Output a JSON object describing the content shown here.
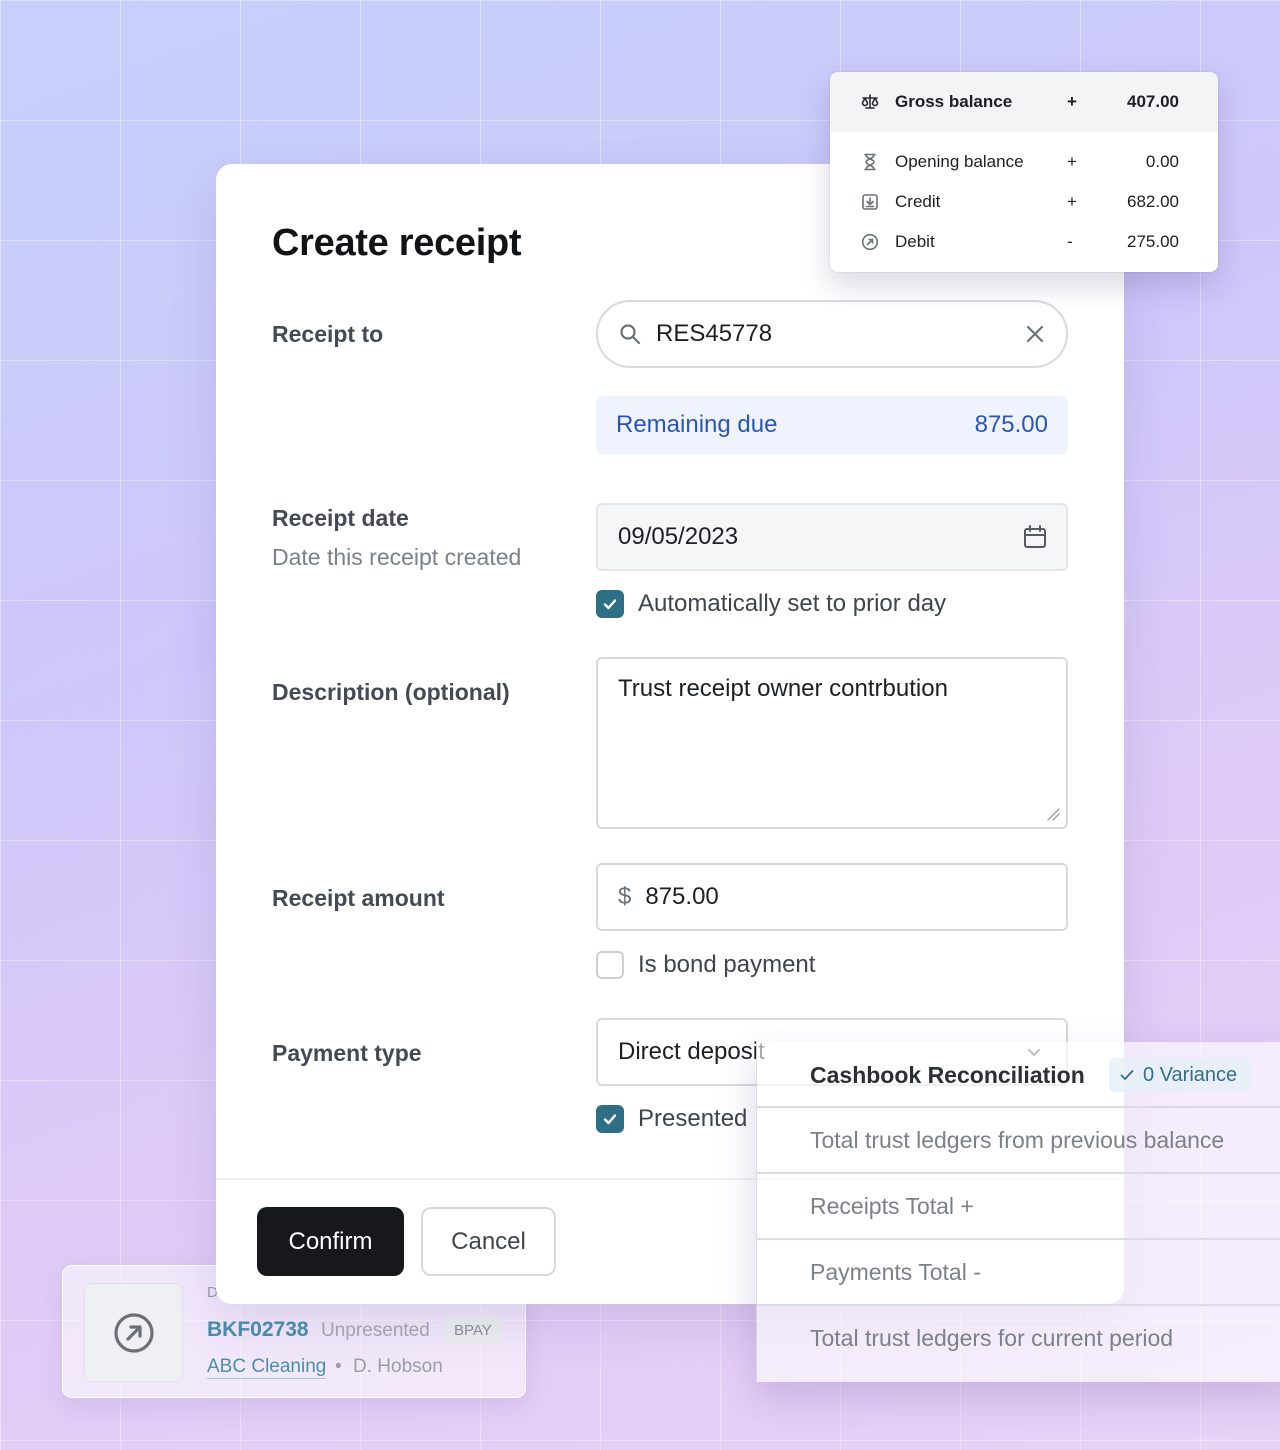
{
  "dialog": {
    "title": "Create receipt",
    "receipt_to": {
      "label": "Receipt to",
      "value": "RES45778"
    },
    "remaining_due": {
      "label": "Remaining due",
      "value": "875.00"
    },
    "receipt_date": {
      "label": "Receipt date",
      "help": "Date this receipt created",
      "value": "09/05/2023",
      "auto_prior_day": {
        "label": "Automatically set to prior day",
        "checked": true
      }
    },
    "description": {
      "label": "Description (optional)",
      "value": "Trust receipt owner contrbution"
    },
    "receipt_amount": {
      "label": "Receipt amount",
      "currency": "$",
      "value": "875.00",
      "bond_payment": {
        "label": "Is bond payment",
        "checked": false
      }
    },
    "payment_type": {
      "label": "Payment type",
      "value": "Direct deposit",
      "presented": {
        "label": "Presented",
        "checked": true
      }
    },
    "actions": {
      "confirm": "Confirm",
      "cancel": "Cancel"
    }
  },
  "balance_card": {
    "rows": [
      {
        "icon": "scale-icon",
        "name": "Gross balance",
        "sign": "+",
        "amount": "407.00"
      },
      {
        "icon": "hourglass-icon",
        "name": "Opening balance",
        "sign": "+",
        "amount": "0.00"
      },
      {
        "icon": "download-box-icon",
        "name": "Credit",
        "sign": "+",
        "amount": "682.00"
      },
      {
        "icon": "arrow-circle-icon",
        "name": "Debit",
        "sign": "-",
        "amount": "275.00"
      }
    ]
  },
  "cashbook": {
    "title": "Cashbook Reconciliation",
    "variance": "0 Variance",
    "rows": [
      "Total trust ledgers from previous balance",
      "Receipts Total +",
      "Payments Total -",
      "Total trust ledgers for current period"
    ]
  },
  "transaction": {
    "clipped_label": "D",
    "id": "BKF02738",
    "status": "Unpresented",
    "tag": "BPAY",
    "client": "ABC Cleaning",
    "separator": "•",
    "person": "D. Hobson"
  },
  "colors": {
    "accent": "#2e6f86",
    "due_text": "#2a56b8",
    "due_bg": "#eef3fd",
    "confirm_bg": "#16181c",
    "link": "#4a8fad"
  }
}
